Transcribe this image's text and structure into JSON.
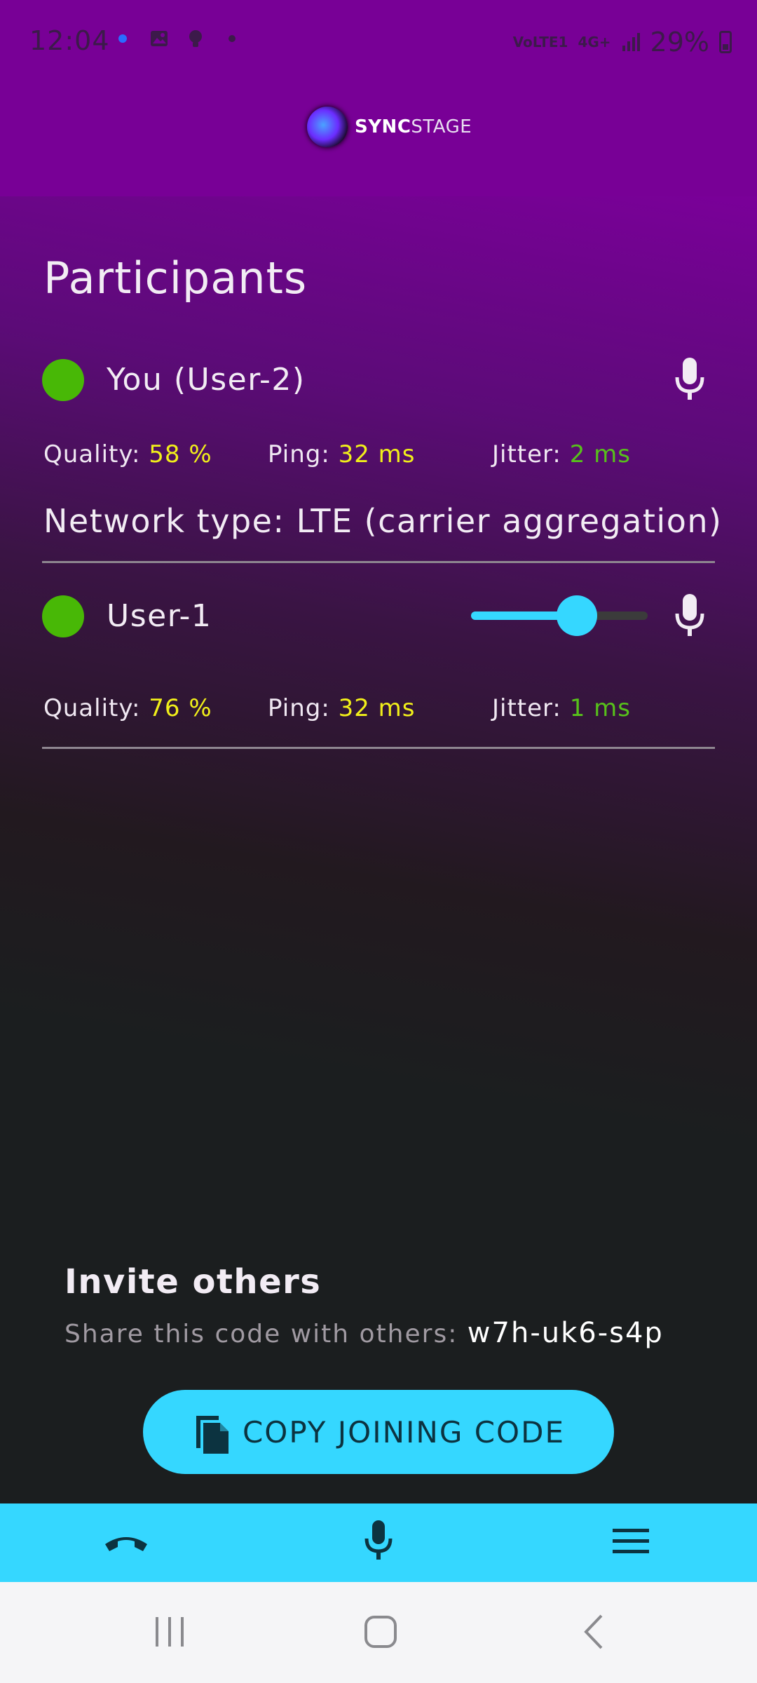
{
  "status_bar": {
    "time": "12:04",
    "network_label": "VoLTE1",
    "network_gen": "4G+",
    "battery": "29%"
  },
  "app": {
    "logo_bold": "SYNC",
    "logo_light": "STAGE"
  },
  "participants": {
    "heading": "Participants",
    "items": [
      {
        "name": "You (User-2)",
        "quality_label": "Quality:",
        "quality_value": "58 %",
        "ping_label": "Ping:",
        "ping_value": "32 ms",
        "jitter_label": "Jitter:",
        "jitter_value": "2 ms",
        "network": "Network type: LTE (carrier aggregation)",
        "status_color": "#48b806"
      },
      {
        "name": "User-1",
        "quality_label": "Quality:",
        "quality_value": "76 %",
        "ping_label": "Ping:",
        "ping_value": "32 ms",
        "jitter_label": "Jitter:",
        "jitter_value": "1 ms",
        "volume_level": 0.6,
        "status_color": "#48b806"
      }
    ]
  },
  "invite": {
    "title": "Invite others",
    "subtitle": "Share this code with others:",
    "code": "w7h-uk6-s4p",
    "copy_button": "COPY JOINING CODE"
  },
  "colors": {
    "header": "#780096",
    "accent": "#35d7ff",
    "online": "#48b806",
    "highlight": "#f1ef1a",
    "jitter": "#57c11b"
  },
  "icons": [
    "hang-up-icon",
    "microphone-icon",
    "menu-icon",
    "copy-icon"
  ]
}
